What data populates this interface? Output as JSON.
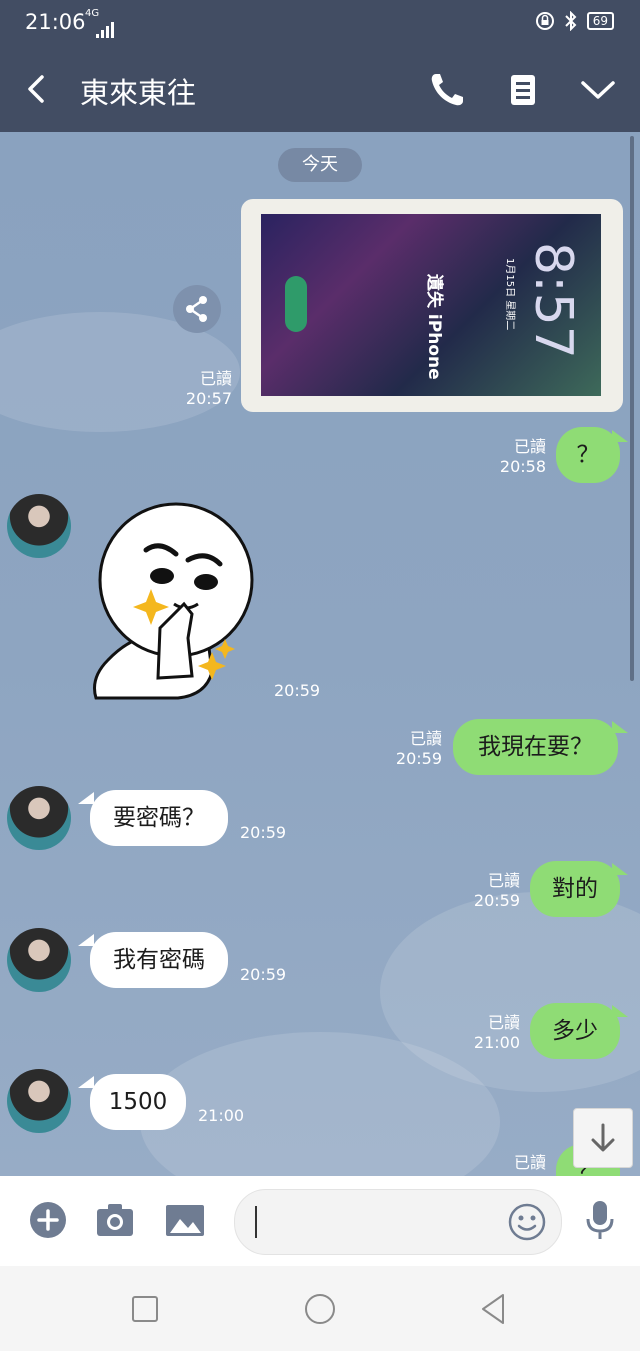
{
  "status": {
    "time": "21:06",
    "network": "4G",
    "battery": "69"
  },
  "header": {
    "title": "東來東往"
  },
  "chat": {
    "date_label": "今天",
    "messages": [
      {
        "dir": "out",
        "type": "photo",
        "read": "已讀",
        "time": "20:57"
      },
      {
        "dir": "out",
        "text": "？",
        "read": "已讀",
        "time": "20:58"
      },
      {
        "dir": "in",
        "type": "sticker",
        "time": "20:59"
      },
      {
        "dir": "out",
        "text": "我現在要？",
        "read": "已讀",
        "time": "20:59"
      },
      {
        "dir": "in",
        "text": "要密碼？",
        "time": "20:59"
      },
      {
        "dir": "out",
        "text": "對的",
        "read": "已讀",
        "time": "20:59"
      },
      {
        "dir": "in",
        "text": "我有密碼",
        "time": "20:59"
      },
      {
        "dir": "out",
        "text": "多少",
        "read": "已讀",
        "time": "21:00"
      },
      {
        "dir": "in",
        "text": "1500",
        "time": "21:00"
      },
      {
        "dir": "out",
        "text": "？",
        "read": "已讀"
      }
    ]
  },
  "photo": {
    "screen_title": "遺失 iPhone",
    "screen_time": "8:57",
    "screen_date": "1月15日 星期二"
  },
  "icons": {
    "back": "chevron-left-icon",
    "call": "phone-icon",
    "notes": "document-icon",
    "menu": "chevron-down-icon",
    "share": "share-icon",
    "add": "plus-circle-icon",
    "camera": "camera-icon",
    "image": "image-icon",
    "emoji": "smiley-icon",
    "mic": "microphone-icon",
    "scroll": "arrow-down-icon"
  },
  "colors": {
    "header": "#424d63",
    "bubble_out": "#8fdc75",
    "bubble_in": "#ffffff",
    "chat_bg": "#8fa6c2"
  }
}
